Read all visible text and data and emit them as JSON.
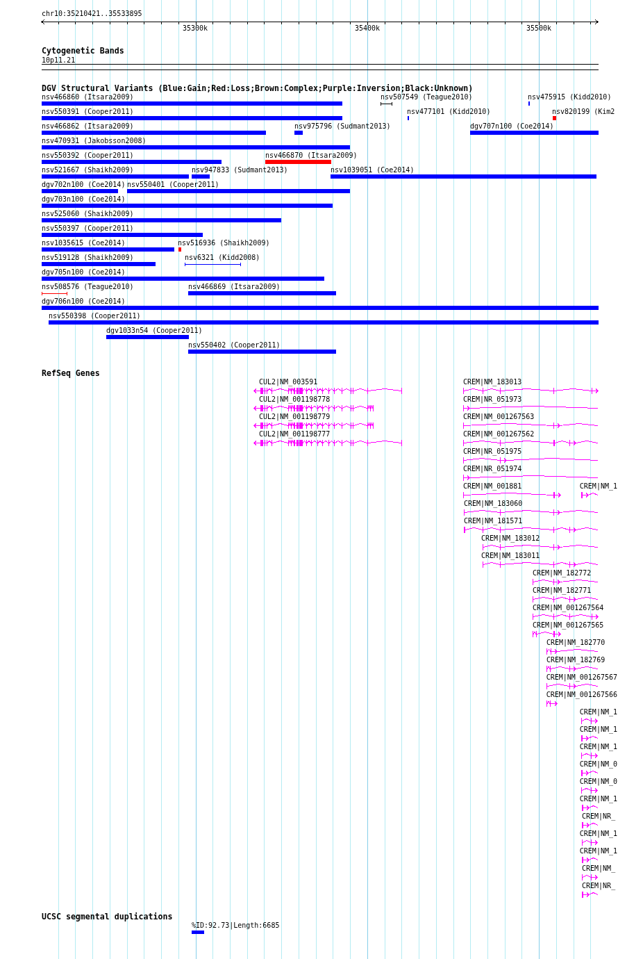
{
  "ruler": {
    "title": "chr10:35210421..35533895",
    "tick_labels": [
      "35300k",
      "35400k",
      "35500k"
    ]
  },
  "tracks": [
    {
      "kind": "bands",
      "title": "Cytogenetic Bands",
      "bands": [
        {
          "label": "10p11.21"
        }
      ]
    },
    {
      "kind": "variants",
      "title": "DGV Structural Variants (Blue:Gain;Red:Loss;Brown:Complex;Purple:Inversion;Black:Unknown)",
      "rows": [
        {
          "features": [
            {
              "label": "nsv466860 (Itsara2009)",
              "kind": "bar",
              "color": "#0000ff"
            },
            {
              "label": "nsv507549 (Teague2010)",
              "kind": "span",
              "color": "#000000"
            },
            {
              "label": "nsv475915 (Kidd2010)",
              "kind": "bar",
              "color": "#0000ff"
            }
          ]
        },
        {
          "features": [
            {
              "label": "nsv550391 (Cooper2011)",
              "kind": "bar",
              "color": "#0000ff"
            },
            {
              "label": "nsv477101 (Kidd2010)",
              "kind": "bar",
              "color": "#0000ff"
            },
            {
              "label": "nsv820199 (Kim2",
              "kind": "bar",
              "color": "#ff0000"
            }
          ]
        },
        {
          "features": [
            {
              "label": "nsv466862 (Itsara2009)",
              "kind": "bar",
              "color": "#0000ff"
            },
            {
              "label": "nsv975796 (Sudmant2013)",
              "kind": "bar",
              "color": "#0000ff"
            },
            {
              "label": "dgv707n100 (Coe2014)",
              "kind": "bar",
              "color": "#0000ff"
            }
          ]
        },
        {
          "features": [
            {
              "label": "nsv470931 (Jakobsson2008)",
              "kind": "bar",
              "color": "#0000ff"
            }
          ]
        },
        {
          "features": [
            {
              "label": "nsv550392 (Cooper2011)",
              "kind": "bar",
              "color": "#0000ff"
            },
            {
              "label": "nsv466870 (Itsara2009)",
              "kind": "bar",
              "color": "#ff0000"
            }
          ]
        },
        {
          "features": [
            {
              "label": "nsv521667 (Shaikh2009)",
              "kind": "bar",
              "color": "#0000ff"
            },
            {
              "label": "nsv947833 (Sudmant2013)",
              "kind": "bar",
              "color": "#0000ff"
            },
            {
              "label": "nsv1039051 (Coe2014)",
              "kind": "bar",
              "color": "#0000ff"
            }
          ]
        },
        {
          "features": [
            {
              "label": "dgv702n100 (Coe2014)",
              "kind": "bar",
              "color": "#0000ff"
            },
            {
              "label": "nsv550401 (Cooper2011)",
              "kind": "bar",
              "color": "#0000ff"
            }
          ]
        },
        {
          "features": [
            {
              "label": "dgv703n100 (Coe2014)",
              "kind": "bar",
              "color": "#0000ff"
            }
          ]
        },
        {
          "features": [
            {
              "label": "nsv525060 (Shaikh2009)",
              "kind": "bar",
              "color": "#0000ff"
            }
          ]
        },
        {
          "features": [
            {
              "label": "nsv550397 (Cooper2011)",
              "kind": "bar",
              "color": "#0000ff"
            }
          ]
        },
        {
          "features": [
            {
              "label": "nsv1035615 (Coe2014)",
              "kind": "bar",
              "color": "#0000ff"
            },
            {
              "label": "nsv516936 (Shaikh2009)",
              "kind": "bar",
              "color": "#ff0000"
            }
          ]
        },
        {
          "features": [
            {
              "label": "nsv519128 (Shaikh2009)",
              "kind": "bar",
              "color": "#0000ff"
            },
            {
              "label": "nsv6321 (Kidd2008)",
              "kind": "span",
              "color": "#0000ff"
            }
          ]
        },
        {
          "features": [
            {
              "label": "dgv705n100 (Coe2014)",
              "kind": "bar",
              "color": "#0000ff"
            }
          ]
        },
        {
          "features": [
            {
              "label": "nsv508576 (Teague2010)",
              "kind": "span",
              "color": "#ff0000"
            },
            {
              "label": "nsv466869 (Itsara2009)",
              "kind": "bar",
              "color": "#0000ff"
            }
          ]
        },
        {
          "features": [
            {
              "label": "dgv706n100 (Coe2014)",
              "kind": "bar",
              "color": "#0000ff"
            }
          ]
        },
        {
          "features": [
            {
              "label": "nsv550398 (Cooper2011)",
              "kind": "bar",
              "color": "#0000ff"
            }
          ]
        },
        {
          "features": [
            {
              "label": "dgv1033n54 (Cooper2011)",
              "kind": "bar",
              "color": "#0000ff"
            }
          ]
        },
        {
          "features": [
            {
              "label": "nsv550402 (Cooper2011)",
              "kind": "bar",
              "color": "#0000ff"
            }
          ]
        }
      ]
    },
    {
      "kind": "genes",
      "title": "RefSeq Genes",
      "rows": [
        {
          "features": [
            {
              "label": "CUL2|NM_003591"
            },
            {
              "label": "CREM|NM_183013"
            }
          ]
        },
        {
          "features": [
            {
              "label": "CUL2|NM_001198778"
            },
            {
              "label": "CREM|NR_051973"
            }
          ]
        },
        {
          "features": [
            {
              "label": "CUL2|NM_001198779"
            },
            {
              "label": "CREM|NM_001267563"
            }
          ]
        },
        {
          "features": [
            {
              "label": "CUL2|NM_001198777"
            },
            {
              "label": "CREM|NM_001267562"
            }
          ]
        },
        {
          "features": [
            {
              "label": "CREM|NR_051975"
            }
          ]
        },
        {
          "features": [
            {
              "label": "CREM|NR_051974"
            }
          ]
        },
        {
          "features": [
            {
              "label": "CREM|NM_001881"
            },
            {
              "label": "CREM|NM_1"
            }
          ]
        },
        {
          "features": [
            {
              "label": "CREM|NM_183060"
            }
          ]
        },
        {
          "features": [
            {
              "label": "CREM|NM_181571"
            }
          ]
        },
        {
          "features": [
            {
              "label": "CREM|NM_183012"
            }
          ]
        },
        {
          "features": [
            {
              "label": "CREM|NM_183011"
            }
          ]
        },
        {
          "features": [
            {
              "label": "CREM|NM_182772"
            }
          ]
        },
        {
          "features": [
            {
              "label": "CREM|NM_182771"
            }
          ]
        },
        {
          "features": [
            {
              "label": "CREM|NM_001267564"
            }
          ]
        },
        {
          "features": [
            {
              "label": "CREM|NM_001267565"
            }
          ]
        },
        {
          "features": [
            {
              "label": "CREM|NM_182770"
            }
          ]
        },
        {
          "features": [
            {
              "label": "CREM|NM_182769"
            }
          ]
        },
        {
          "features": [
            {
              "label": "CREM|NM_001267567"
            }
          ]
        },
        {
          "features": [
            {
              "label": "CREM|NM_001267566"
            }
          ]
        },
        {
          "features": [
            {
              "label": "CREM|NM_1"
            }
          ]
        },
        {
          "features": [
            {
              "label": "CREM|NM_1"
            }
          ]
        },
        {
          "features": [
            {
              "label": "CREM|NM_1"
            }
          ]
        },
        {
          "features": [
            {
              "label": "CREM|NM_0"
            }
          ]
        },
        {
          "features": [
            {
              "label": "CREM|NM_0"
            }
          ]
        },
        {
          "features": [
            {
              "label": "CREM|NM_1"
            }
          ]
        },
        {
          "features": [
            {
              "label": "CREM|NR_"
            }
          ]
        },
        {
          "features": [
            {
              "label": "CREM|NM_1"
            }
          ]
        },
        {
          "features": [
            {
              "label": "CREM|NM_1"
            }
          ]
        },
        {
          "features": [
            {
              "label": "CREM|NM_"
            }
          ]
        },
        {
          "features": [
            {
              "label": "CREM|NR_"
            }
          ]
        }
      ]
    },
    {
      "kind": "duplications",
      "title": "UCSC segmental duplications",
      "rows": [
        {
          "features": [
            {
              "label": "%ID:92.73|Length:6685"
            }
          ]
        }
      ]
    }
  ]
}
